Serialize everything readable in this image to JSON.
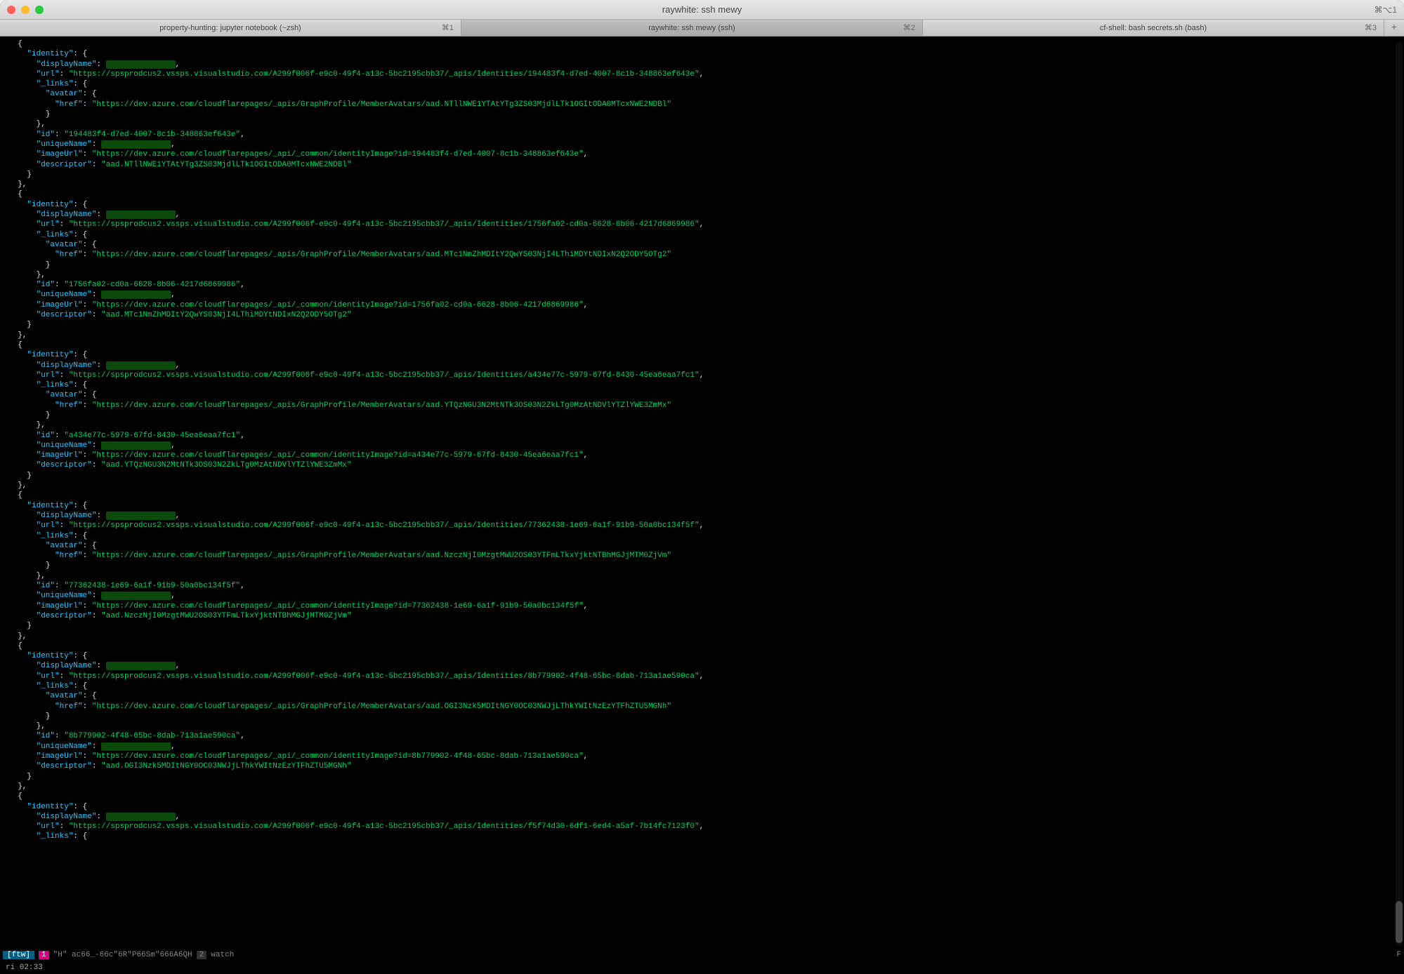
{
  "window": {
    "title": "raywhite: ssh mewy",
    "shortcut_hint": "⌘⌥1"
  },
  "tabs": [
    {
      "label": "property-hunting: jupyter notebook (~zsh)",
      "shortcut": "⌘1",
      "active": false
    },
    {
      "label": "raywhite: ssh mewy (ssh)",
      "shortcut": "⌘2",
      "active": true
    },
    {
      "label": "cf-shell: bash secrets.sh (bash)",
      "shortcut": "⌘3",
      "active": false
    }
  ],
  "json_output": {
    "entries": [
      {
        "identity": {
          "displayName": "[redacted]",
          "url": "https://spsprodcus2.vssps.visualstudio.com/A299f006f-e9c0-49f4-a13c-5bc2195cbb37/_apis/Identities/194483f4-d7ed-4007-8c1b-348863ef643e",
          "_links": {
            "avatar": {
              "href": "https://dev.azure.com/cloudflarepages/_apis/GraphProfile/MemberAvatars/aad.NTllNWE1YTAtYTg3ZS03MjdlLTk1OGItODA0MTcxNWE2NDBl"
            }
          },
          "id": "194483f4-d7ed-4007-8c1b-348863ef643e",
          "uniqueName": "[redacted]",
          "imageUrl": "https://dev.azure.com/cloudflarepages/_api/_common/identityImage?id=194483f4-d7ed-4007-8c1b-348863ef643e",
          "descriptor": "aad.NTllNWE1YTAtYTg3ZS03MjdlLTk1OGItODA0MTcxNWE2NDBl"
        }
      },
      {
        "identity": {
          "displayName": "[redacted]",
          "url": "https://spsprodcus2.vssps.visualstudio.com/A299f006f-e9c0-49f4-a13c-5bc2195cbb37/_apis/Identities/1756fa02-cd0a-6628-8b06-4217d6869986",
          "_links": {
            "avatar": {
              "href": "https://dev.azure.com/cloudflarepages/_apis/GraphProfile/MemberAvatars/aad.MTc1NmZhMDItY2QwYS03NjI4LThiMDYtNDIxN2Q2ODY5OTg2"
            }
          },
          "id": "1756fa02-cd0a-6628-8b06-4217d6869986",
          "uniqueName": "[redacted]",
          "imageUrl": "https://dev.azure.com/cloudflarepages/_api/_common/identityImage?id=1756fa02-cd0a-6628-8b06-4217d6869986",
          "descriptor": "aad.MTc1NmZhMDItY2QwYS03NjI4LThiMDYtNDIxN2Q2ODY5OTg2"
        }
      },
      {
        "identity": {
          "displayName": "[redacted]",
          "url": "https://spsprodcus2.vssps.visualstudio.com/A299f006f-e9c0-49f4-a13c-5bc2195cbb37/_apis/Identities/a434e77c-5979-67fd-8430-45ea6eaa7fc1",
          "_links": {
            "avatar": {
              "href": "https://dev.azure.com/cloudflarepages/_apis/GraphProfile/MemberAvatars/aad.YTQzNGU3N2MtNTk3OS03N2ZkLTg0MzAtNDVlYTZlYWE3ZmMx"
            }
          },
          "id": "a434e77c-5979-67fd-8430-45ea6eaa7fc1",
          "uniqueName": "[redacted]",
          "imageUrl": "https://dev.azure.com/cloudflarepages/_api/_common/identityImage?id=a434e77c-5979-67fd-8430-45ea6eaa7fc1",
          "descriptor": "aad.YTQzNGU3N2MtNTk3OS03N2ZkLTg0MzAtNDVlYTZlYWE3ZmMx"
        }
      },
      {
        "identity": {
          "displayName": "[redacted]",
          "url": "https://spsprodcus2.vssps.visualstudio.com/A299f006f-e9c0-49f4-a13c-5bc2195cbb37/_apis/Identities/77362438-1e69-6a1f-91b9-50a0bc134f5f",
          "_links": {
            "avatar": {
              "href": "https://dev.azure.com/cloudflarepages/_apis/GraphProfile/MemberAvatars/aad.NzczNjI0MzgtMWU2OS03YTFmLTkxYjktNTBhMGJjMTM0ZjVm"
            }
          },
          "id": "77362438-1e69-6a1f-91b9-50a0bc134f5f",
          "uniqueName": "[redacted]",
          "imageUrl": "https://dev.azure.com/cloudflarepages/_api/_common/identityImage?id=77362438-1e69-6a1f-91b9-50a0bc134f5f",
          "descriptor": "aad.NzczNjI0MzgtMWU2OS03YTFmLTkxYjktNTBhMGJjMTM0ZjVm"
        }
      },
      {
        "identity": {
          "displayName": "[redacted]",
          "url": "https://spsprodcus2.vssps.visualstudio.com/A299f006f-e9c0-49f4-a13c-5bc2195cbb37/_apis/Identities/8b779902-4f48-65bc-8dab-713a1ae590ca",
          "_links": {
            "avatar": {
              "href": "https://dev.azure.com/cloudflarepages/_apis/GraphProfile/MemberAvatars/aad.OGI3Nzk5MDItNGY0OC03NWJjLThkYWItNzEzYTFhZTU5MGNh"
            }
          },
          "id": "8b779902-4f48-65bc-8dab-713a1ae590ca",
          "uniqueName": "[redacted]",
          "imageUrl": "https://dev.azure.com/cloudflarepages/_api/_common/identityImage?id=8b779902-4f48-65bc-8dab-713a1ae590ca",
          "descriptor": "aad.OGI3Nzk5MDItNGY0OC03NWJjLThkYWItNzEzYTFhZTU5MGNh"
        }
      },
      {
        "identity_partial": {
          "displayName": "[redacted]",
          "url": "https://spsprodcus2.vssps.visualstudio.com/A299f006f-e9c0-49f4-a13c-5bc2195cbb37/_apis/Identities/f5f74d30-6df1-6ed4-a5af-7b14fc7123f0",
          "_links_open": true
        }
      }
    ]
  },
  "status": {
    "session": "[ftw]",
    "win1": "1",
    "win1_text": "\"H\" ac66_-66c\"6R\"P66Sm\"666A6QH",
    "win2": "2",
    "win2_text": "watch",
    "right_indicator": "F"
  },
  "bottom": {
    "clock": "ri 02:33"
  }
}
